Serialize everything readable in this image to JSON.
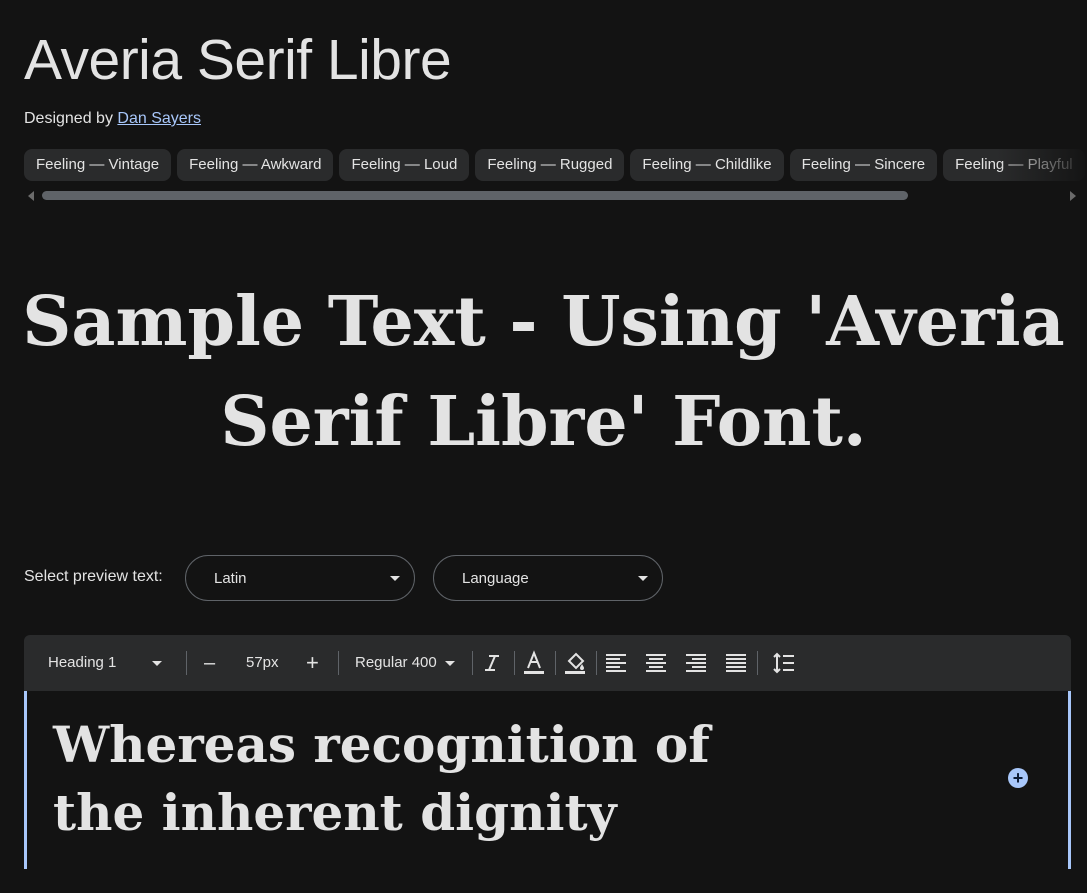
{
  "font": {
    "name": "Averia Serif Libre",
    "designed_by_label": "Designed by",
    "designer": "Dan Sayers"
  },
  "tags": [
    "Feeling — Vintage",
    "Feeling — Awkward",
    "Feeling — Loud",
    "Feeling — Rugged",
    "Feeling — Childlike",
    "Feeling — Sincere",
    "Feeling — Playful"
  ],
  "sample_text": "Sample Text - Using 'Averia Serif Libre' Font.",
  "preview": {
    "label": "Select preview text:",
    "script_value": "Latin",
    "language_value": "Language"
  },
  "toolbar": {
    "style_value": "Heading 1",
    "decrease": "–",
    "size_value": "57px",
    "increase": "+",
    "weight_value": "Regular 400"
  },
  "icons": {
    "italic": "italic-icon",
    "text_color": "text-color-icon",
    "fill_color": "fill-color-icon",
    "align_left": "align-left-icon",
    "align_center": "align-center-icon",
    "align_right": "align-right-icon",
    "align_justify": "align-justify-icon",
    "line_height": "line-height-icon",
    "add": "add-icon"
  },
  "editor_text": "Whereas recognition of the inherent dignity",
  "colors": {
    "background": "#131313",
    "accent": "#a8c7fa",
    "chip": "#2a2b2c"
  }
}
